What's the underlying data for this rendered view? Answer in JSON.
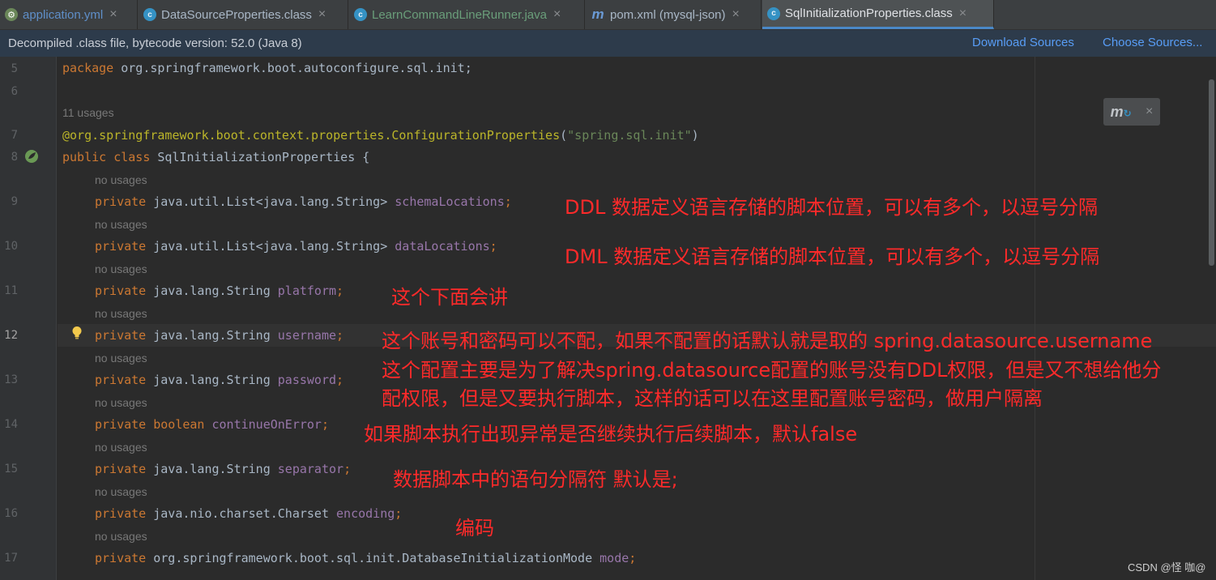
{
  "tabs": [
    {
      "label": "application.yml",
      "icon": "spring-yaml-icon",
      "active": false
    },
    {
      "label": "DataSourceProperties.class",
      "icon": "class-icon",
      "active": false
    },
    {
      "label": "LearnCommandLineRunner.java",
      "icon": "class-icon",
      "active": false
    },
    {
      "label": "pom.xml (mysql-json)",
      "icon": "maven-icon",
      "active": false
    },
    {
      "label": "SqlInitializationProperties.class",
      "icon": "class-icon",
      "active": true
    }
  ],
  "close_glyph": "×",
  "infobar": {
    "message": "Decompiled .class file, bytecode version: 52.0 (Java 8)",
    "download_sources": "Download Sources",
    "choose_sources": "Choose Sources..."
  },
  "line_numbers": [
    "5",
    "6",
    "7",
    "8",
    "9",
    "10",
    "11",
    "12",
    "13",
    "14",
    "15",
    "16",
    "17"
  ],
  "hints": {
    "usages_11": "11 usages",
    "no_usages": "no usages"
  },
  "code": {
    "l5_kw": "package",
    "l5_rest": " org.springframework.boot.autoconfigure.sql.init;",
    "l7_at": "@org.springframework.boot.context.properties.",
    "l7_ann": "ConfigurationProperties",
    "l7_open": "(",
    "l7_str": "\"spring.sql.init\"",
    "l7_close": ")",
    "l8_kw": "public class",
    "l8_rest": " SqlInitializationProperties {",
    "private": "private",
    "boolean": "boolean",
    "l9_type": " java.util.List<java.lang.String> ",
    "l9_field": "schemaLocations",
    "l10_type": " java.util.List<java.lang.String> ",
    "l10_field": "dataLocations",
    "l11_type": " java.lang.String ",
    "l11_field": "platform",
    "l12_type": " java.lang.String ",
    "l12_field": "username",
    "l13_type": " java.lang.String ",
    "l13_field": "password",
    "l14_field": "continueOnError",
    "l15_type": " java.lang.String ",
    "l15_field": "separator",
    "l16_type": " java.nio.charset.Charset ",
    "l16_field": "encoding",
    "l17_type": " org.springframework.boot.sql.init.DatabaseInitializationMode ",
    "l17_field": "mode",
    "semi": ";"
  },
  "annotations": {
    "schema": "DDL 数据定义语言存储的脚本位置，可以有多个，以逗号分隔",
    "data": "DML 数据定义语言存储的脚本位置，可以有多个，以逗号分隔",
    "platform": "这个下面会讲",
    "username": "这个账号和密码可以不配，如果不配置的话默认就是取的  spring.datasource.username",
    "password_1": "这个配置主要是为了解决spring.datasource配置的账号没有DDL权限，但是又不想给他分",
    "password_2": "配权限，但是又要执行脚本，这样的话可以在这里配置账号密码，做用户隔离",
    "continue": "如果脚本执行出现异常是否继续执行后续脚本，默认false",
    "separator": "数据脚本中的语句分隔符 默认是;",
    "encoding": "编码"
  },
  "maven_popup": {
    "icon": "maven-reload-icon",
    "close": "×"
  },
  "watermark": "CSDN @怪 咖@",
  "colors": {
    "background": "#2b2b2b",
    "keyword": "#cc7832",
    "field": "#9876aa",
    "annotation": "#bbb529",
    "string": "#6a8759",
    "note_red": "#ff2a2a",
    "link": "#589df6"
  }
}
